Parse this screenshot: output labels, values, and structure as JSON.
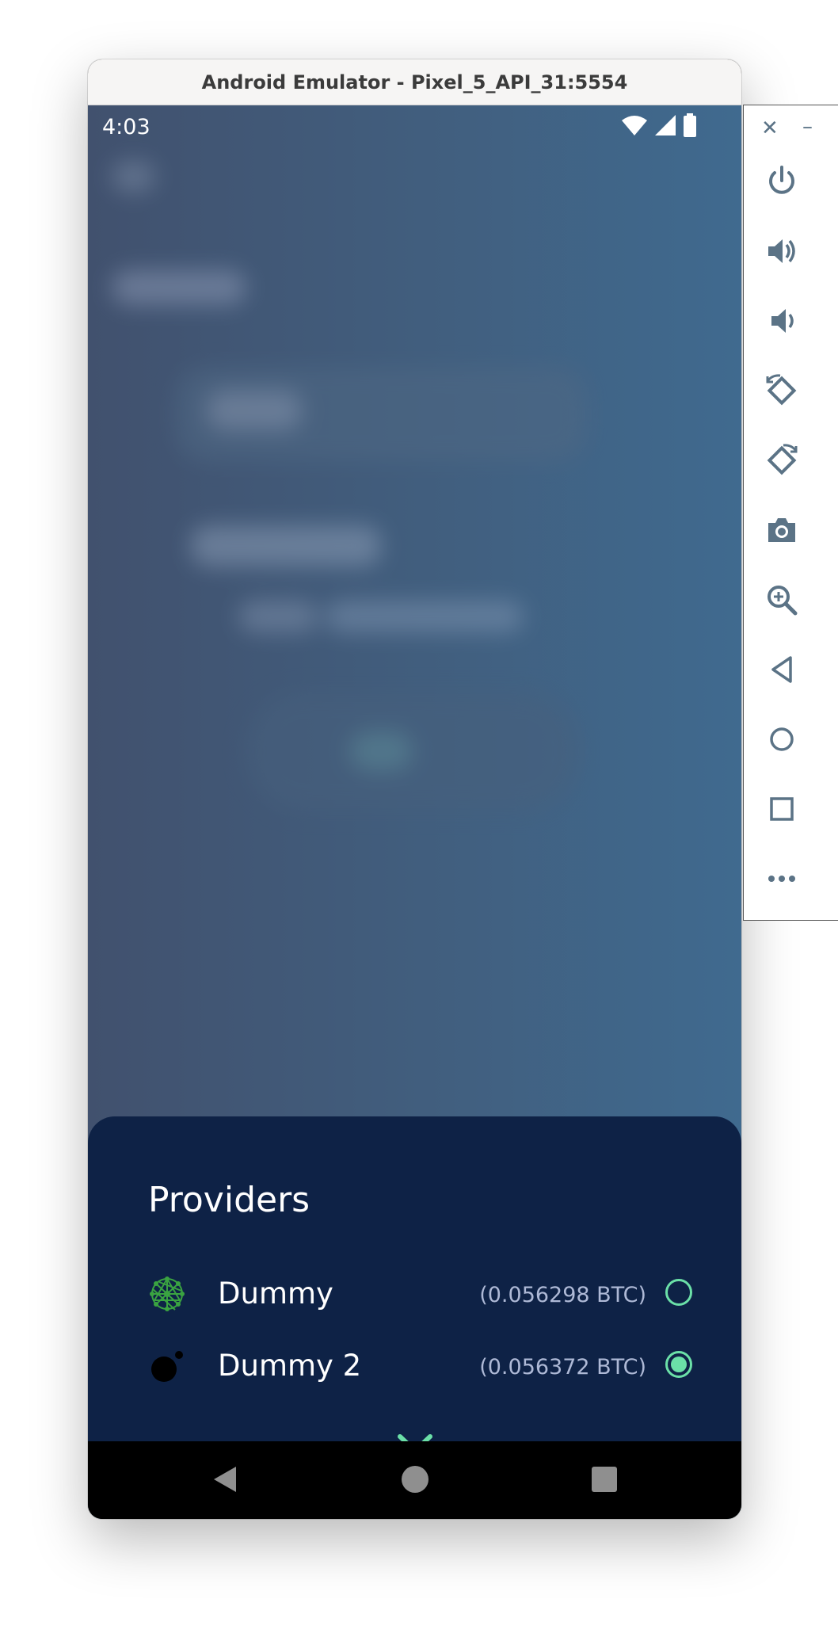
{
  "window": {
    "title": "Android Emulator - Pixel_5_API_31:5554"
  },
  "status_bar": {
    "time": "4:03",
    "icons": [
      "wifi-icon",
      "signal-icon",
      "battery-icon"
    ]
  },
  "sheet": {
    "title": "Providers",
    "providers": [
      {
        "name": "Dummy",
        "amount": "(0.056298 BTC)",
        "selected": false,
        "icon": "network-globe-icon"
      },
      {
        "name": "Dummy 2",
        "amount": "(0.056372 BTC)",
        "selected": true,
        "icon": "bomb-dot-icon"
      }
    ],
    "collapse_icon": "chevron-down-icon"
  },
  "nav_bar": {
    "buttons": [
      "back-icon",
      "home-icon",
      "recents-icon"
    ]
  },
  "emulator_toolbar": {
    "controls": [
      "close-icon",
      "minimize-icon"
    ],
    "buttons": [
      "power-icon",
      "volume-up-icon",
      "volume-down-icon",
      "rotate-left-icon",
      "rotate-right-icon",
      "camera-icon",
      "zoom-icon",
      "back-icon",
      "home-icon",
      "overview-icon",
      "more-icon"
    ]
  },
  "colors": {
    "sheet_bg": "#0e2246",
    "accent": "#6be0a8",
    "amount_text": "#aeb9d6",
    "toolbar_icon": "#5b7386"
  }
}
